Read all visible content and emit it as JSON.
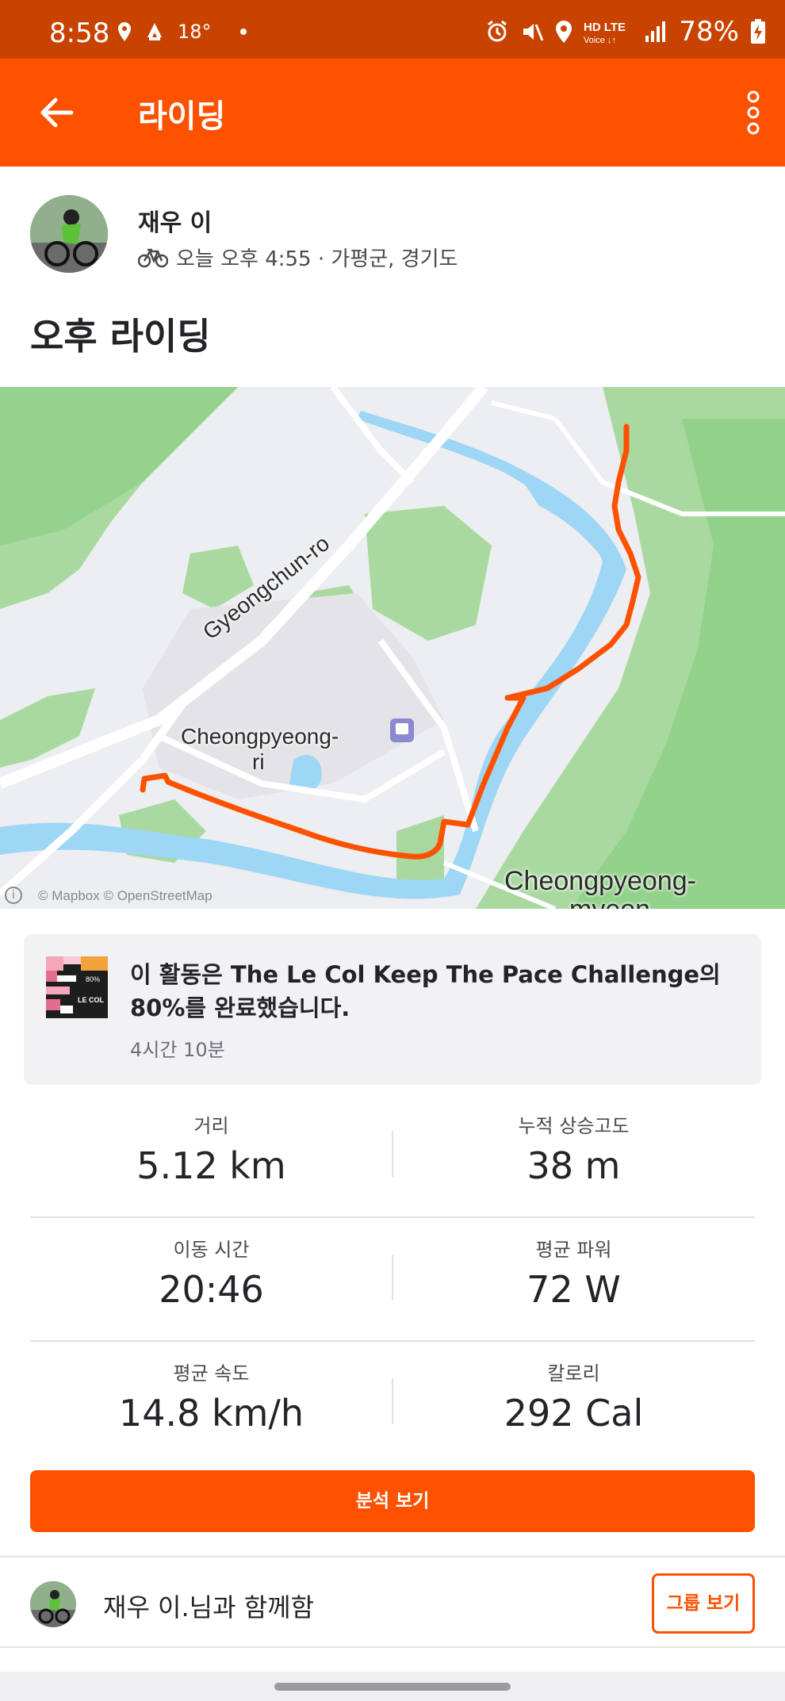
{
  "status_bar": {
    "time": "8:58",
    "temperature": "18°",
    "battery": "78%"
  },
  "app_bar": {
    "title": "라이딩"
  },
  "athlete": {
    "name": "재우 이",
    "meta": "오늘 오후 4:55 · 가평군, 경기도",
    "activity_icon": "bike-icon"
  },
  "activity": {
    "title": "오후 라이딩"
  },
  "map": {
    "road_label": "Gyeongchun-ro",
    "town_label_line1": "Cheongpyeong-",
    "town_label_line2": "ri",
    "district_label_line1": "Cheongpyeong-",
    "district_label_line2": "myeon",
    "attribution": "© Mapbox © OpenStreetMap",
    "route_color": "#fc5200"
  },
  "challenge": {
    "text": "이 활동은 The Le Col Keep The Pace Challenge의 80%를 완료했습니다.",
    "subtext": "4시간 10분",
    "badge_progress": "80%",
    "badge_brand": "LE COL"
  },
  "stats": [
    {
      "label": "거리",
      "value": "5.12 km"
    },
    {
      "label": "누적 상승고도",
      "value": "38 m"
    },
    {
      "label": "이동 시간",
      "value": "20:46"
    },
    {
      "label": "평균 파워",
      "value": "72 W"
    },
    {
      "label": "평균 속도",
      "value": "14.8 km/h"
    },
    {
      "label": "칼로리",
      "value": "292 Cal"
    }
  ],
  "actions": {
    "analysis_label": "분석 보기"
  },
  "group": {
    "text": "재우 이.님과 함께함",
    "button_label": "그룹 보기"
  },
  "colors": {
    "brand": "#fc5200",
    "status_bar": "#c94300"
  }
}
